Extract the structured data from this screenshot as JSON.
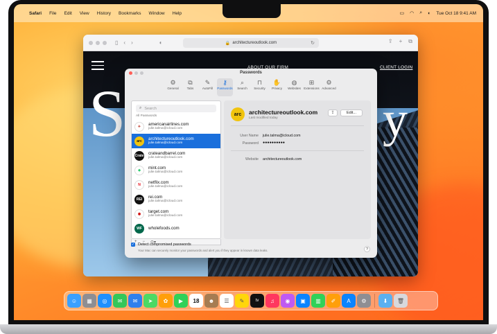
{
  "menubar": {
    "app_name": "Safari",
    "items": [
      "File",
      "Edit",
      "View",
      "History",
      "Bookmarks",
      "Window",
      "Help"
    ],
    "datetime": "Tue Oct 18  9:41 AM"
  },
  "safari": {
    "url": "architectureoutlook.com",
    "nav_about": "ABOUT OUR FIRM",
    "nav_client": "CLIENT LOGIN",
    "headline_left": "S",
    "headline_right": "y"
  },
  "prefs": {
    "title": "Passwords",
    "tabs": [
      "General",
      "Tabs",
      "AutoFill",
      "Passwords",
      "Search",
      "Security",
      "Privacy",
      "Websites",
      "Extensions",
      "Advanced"
    ],
    "active_tab": "Passwords",
    "search_placeholder": "Search",
    "all_passwords": "All Passwords",
    "entries": [
      {
        "domain": "americanairlines.com",
        "user": "julie.talma@icloud.com",
        "logo": "✈",
        "color": "#ffffff",
        "fg": "#c0392b"
      },
      {
        "domain": "architectureoutlook.com",
        "user": "julie.talma@icloud.com",
        "logo": "arc",
        "color": "#f1c40f",
        "fg": "#111111"
      },
      {
        "domain": "crateandbarrel.com",
        "user": "julie.talma@icloud.com",
        "logo": "Crate",
        "color": "#111111",
        "fg": "#ffffff"
      },
      {
        "domain": "mint.com",
        "user": "julie.talma@icloud.com",
        "logo": "◆",
        "color": "#ffffff",
        "fg": "#2ecc71"
      },
      {
        "domain": "netflix.com",
        "user": "julie.talma@icloud.com",
        "logo": "N",
        "color": "#ffffff",
        "fg": "#e50914"
      },
      {
        "domain": "rei.com",
        "user": "julie.talma@icloud.com",
        "logo": "REI",
        "color": "#111111",
        "fg": "#ffffff"
      },
      {
        "domain": "target.com",
        "user": "julie.talma@icloud.com",
        "logo": "◉",
        "color": "#ffffff",
        "fg": "#cc0000"
      },
      {
        "domain": "wholefoods.com",
        "user": "",
        "logo": "WF",
        "color": "#00674b",
        "fg": "#ffffff"
      }
    ],
    "footer": {
      "add": "+",
      "remove": "−",
      "more": "⊙▾"
    },
    "detail": {
      "logo": "arc",
      "site": "architectureoutlook.com",
      "modified": "Last modified today",
      "edit_label": "Edit...",
      "username_label": "User Name",
      "username": "julie.talma@icloud.com",
      "password_label": "Password",
      "password": "●●●●●●●●●●",
      "website_label": "Website",
      "website": "architectureoutlook.com"
    },
    "detect_label": "Detect compromised passwords",
    "detect_sub": "Your Mac can securely monitor your passwords and alert you if they appear in known data leaks.",
    "help": "?"
  },
  "dock": {
    "calendar_day": "18",
    "tv_label": "tv",
    "apps": [
      {
        "name": "finder",
        "color": "#3aa0ff",
        "glyph": "☺"
      },
      {
        "name": "launchpad",
        "color": "#8e8e93",
        "glyph": "▦"
      },
      {
        "name": "safari",
        "color": "#1e90ff",
        "glyph": "◎"
      },
      {
        "name": "messages",
        "color": "#34c759",
        "glyph": "✉"
      },
      {
        "name": "mail",
        "color": "#2f80ed",
        "glyph": "✉"
      },
      {
        "name": "maps",
        "color": "#4cd964",
        "glyph": "➤"
      },
      {
        "name": "photos",
        "color": "#ff9f0a",
        "glyph": "✿"
      },
      {
        "name": "facetime",
        "color": "#30d158",
        "glyph": "▶"
      },
      {
        "name": "calendar",
        "color": "#ffffff",
        "glyph": "cal"
      },
      {
        "name": "contacts",
        "color": "#a67c52",
        "glyph": "☻"
      },
      {
        "name": "reminders",
        "color": "#ffffff",
        "glyph": "☰"
      },
      {
        "name": "notes",
        "color": "#ffd60a",
        "glyph": "✎"
      },
      {
        "name": "tv",
        "color": "#111111",
        "glyph": "tv"
      },
      {
        "name": "music",
        "color": "#ff375f",
        "glyph": "♫"
      },
      {
        "name": "podcasts",
        "color": "#bf5af2",
        "glyph": "◉"
      },
      {
        "name": "keynote",
        "color": "#0a84ff",
        "glyph": "▣"
      },
      {
        "name": "numbers",
        "color": "#30d158",
        "glyph": "▥"
      },
      {
        "name": "pages",
        "color": "#ff9f0a",
        "glyph": "✐"
      },
      {
        "name": "app-store",
        "color": "#0a84ff",
        "glyph": "A"
      },
      {
        "name": "system-settings",
        "color": "#8e8e93",
        "glyph": "⚙"
      }
    ],
    "trailing": [
      {
        "name": "downloads-folder",
        "color": "#5ab0f0",
        "glyph": "⬇"
      },
      {
        "name": "trash",
        "color": "#d8d8dc",
        "glyph": "🗑"
      }
    ]
  }
}
